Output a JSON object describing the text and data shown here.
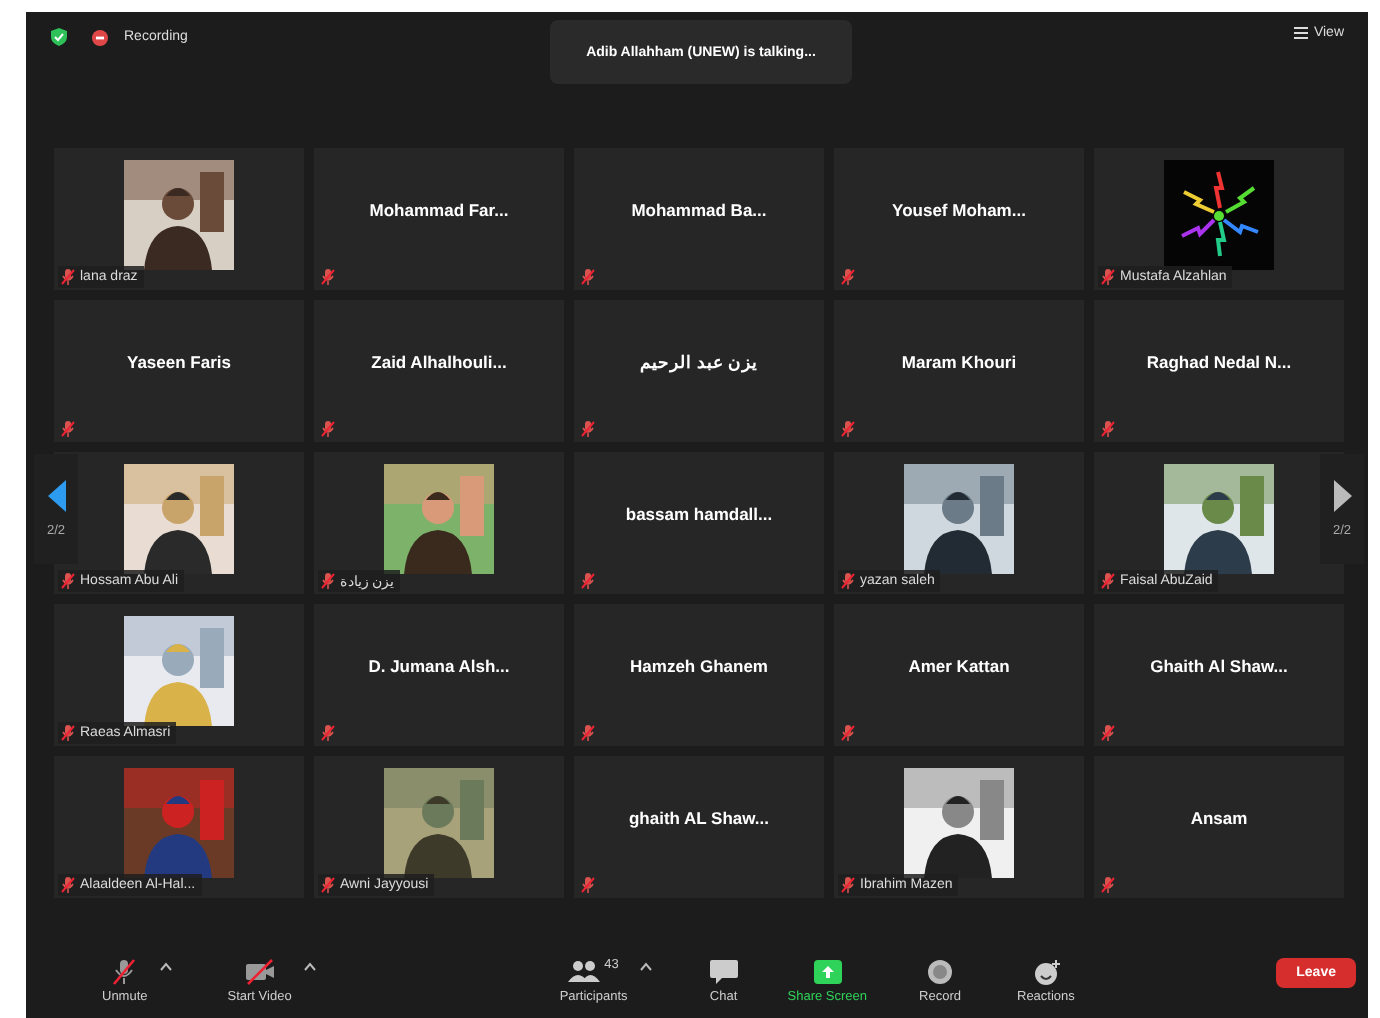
{
  "top_bar": {
    "recording": "Recording",
    "speaker": "Adib Allahham (UNEW) is talking...",
    "view": "View"
  },
  "participants": [
    {
      "kind": "picture",
      "name": "lana draz"
    },
    {
      "kind": "name",
      "name": "Mohammad  Far..."
    },
    {
      "kind": "name",
      "name": "Mohammad  Ba..."
    },
    {
      "kind": "name",
      "name": "Yousef  Moham..."
    },
    {
      "kind": "picture",
      "name": "Mustafa Alzahlan"
    },
    {
      "kind": "name",
      "name": "Yaseen Faris"
    },
    {
      "kind": "name",
      "name": "Zaid  Alhalhouli..."
    },
    {
      "kind": "name",
      "name": "يزن عبد الرحيم"
    },
    {
      "kind": "name",
      "name": "Maram Khouri"
    },
    {
      "kind": "name",
      "name": "Raghad  Nedal  N..."
    },
    {
      "kind": "picture",
      "name": "Hossam Abu Ali"
    },
    {
      "kind": "picture",
      "name": "يزن زيادة"
    },
    {
      "kind": "name",
      "name": "bassam  hamdall..."
    },
    {
      "kind": "picture",
      "name": "yazan saleh"
    },
    {
      "kind": "picture",
      "name": "Faisal AbuZaid"
    },
    {
      "kind": "picture",
      "name": "Raeas Almasri"
    },
    {
      "kind": "name",
      "name": "D. Jumana  Alsh..."
    },
    {
      "kind": "name",
      "name": "Hamzeh Ghanem"
    },
    {
      "kind": "name",
      "name": "Amer Kattan"
    },
    {
      "kind": "name",
      "name": "Ghaith   Al Shaw..."
    },
    {
      "kind": "picture",
      "name": "Alaaldeen Al-Hal..."
    },
    {
      "kind": "picture",
      "name": "Awni Jayyousi"
    },
    {
      "kind": "name",
      "name": "ghaith  AL  Shaw..."
    },
    {
      "kind": "picture",
      "name": "Ibrahim Mazen"
    },
    {
      "kind": "name",
      "name": "Ansam"
    }
  ],
  "pager": {
    "left": "2/2",
    "right": "2/2"
  },
  "toolbar": [
    {
      "kind": "mic",
      "label": "Unmute",
      "menu": true
    },
    {
      "kind": "video",
      "label": "Start Video",
      "menu": true
    },
    {
      "kind": "participants",
      "label": "Participants",
      "count": "43",
      "menu": true
    },
    {
      "kind": "chat",
      "label": "Chat",
      "menu": false
    },
    {
      "kind": "share",
      "label": "Share Screen",
      "menu": false
    },
    {
      "kind": "record",
      "label": "Record",
      "menu": false
    },
    {
      "kind": "reactions",
      "label": "Reactions",
      "menu": false
    }
  ],
  "leave": "Leave"
}
